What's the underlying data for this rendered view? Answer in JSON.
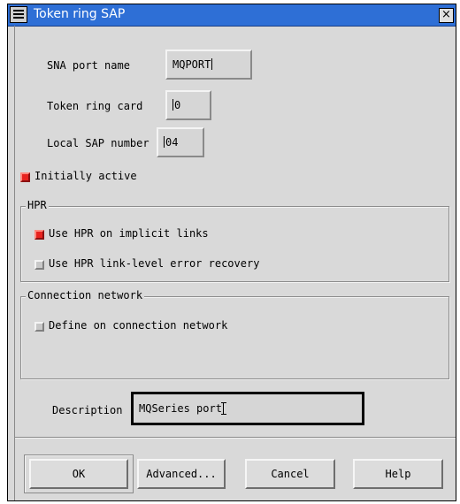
{
  "window": {
    "title": "Token ring SAP",
    "close_glyph": "×"
  },
  "fields": {
    "sna_port_name": {
      "label": "SNA port name",
      "value": "MQPORT"
    },
    "token_ring_card": {
      "label": "Token ring card",
      "value": "0"
    },
    "local_sap_number": {
      "label": "Local SAP number",
      "value": "04"
    },
    "description": {
      "label": "Description",
      "value": "MQSeries port"
    }
  },
  "checks": {
    "initially_active": {
      "label": "Initially active",
      "checked": true
    },
    "use_hpr_implicit": {
      "label": "Use HPR on implicit links",
      "checked": true
    },
    "use_hpr_error_recovery": {
      "label": "Use HPR link-level error recovery",
      "checked": false
    },
    "define_on_connection_network": {
      "label": "Define on connection network",
      "checked": false
    }
  },
  "groups": {
    "hpr": {
      "title": "HPR"
    },
    "connection_network": {
      "title": "Connection network"
    }
  },
  "buttons": {
    "ok": "OK",
    "advanced": "Advanced...",
    "cancel": "Cancel",
    "help": "Help"
  },
  "colors": {
    "title_bar": "#2e6fd6",
    "check_on": "#e8231f",
    "dialog_bg": "#d9d9d9"
  },
  "icons": {
    "window_menu": "window-menu-icon",
    "close": "close-icon"
  }
}
